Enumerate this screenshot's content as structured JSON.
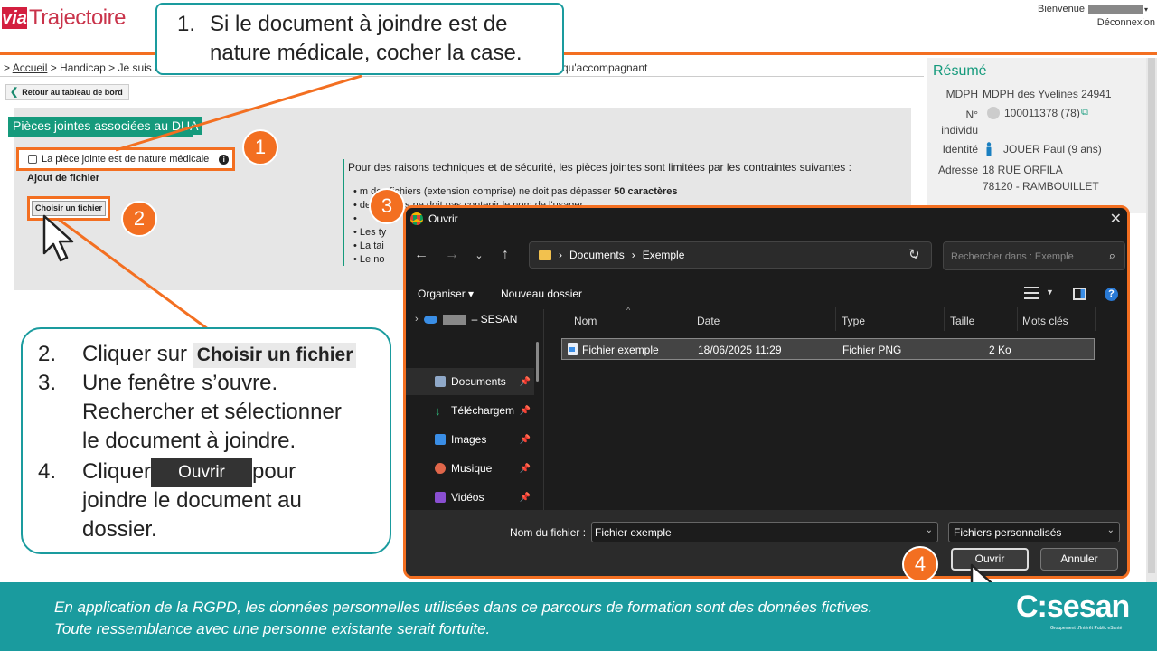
{
  "header": {
    "logo_via": "via",
    "logo_name": "Trajectoire",
    "welcome": "Bienvenue",
    "logout": "Déconnexion"
  },
  "breadcrumb": {
    "prefix": ">",
    "home": "Accueil",
    "rest": "> Handicap > Je suis a",
    "tail": "qu'accompagnant"
  },
  "back_button": "Retour au tableau de bord",
  "attachments": {
    "title": "Pièces jointes associées au DUA",
    "medical_checkbox": "La pièce jointe est de nature médicale",
    "add_file": "Ajout de fichier",
    "choose_file": "Choisir un fichier",
    "constraints_intro": "Pour des raisons techniques et de sécurité, les pièces jointes sont limitées par les contraintes suivantes :",
    "bullets": [
      "• m des fichiers (extension comprise) ne doit pas dépasser 50 caractères",
      "• des fichiers ne doit pas contenir le nom de l'usager",
      "•",
      "• Les ty",
      "• La tai",
      "• Le no"
    ]
  },
  "summary": {
    "title": "Résumé",
    "rows": [
      {
        "label": "MDPH",
        "value": "MDPH des Yvelines 24941"
      },
      {
        "label": "N° individu",
        "value": "100011378 (78)"
      },
      {
        "label": "Identité",
        "value": "JOUER Paul (9 ans)"
      },
      {
        "label": "Adresse",
        "value": "18 RUE ORFILA"
      },
      {
        "label": "",
        "value": "78120 - RAMBOUILLET"
      }
    ]
  },
  "dialog": {
    "title": "Ouvrir",
    "path": [
      "Documents",
      "Exemple"
    ],
    "search_placeholder": "Rechercher dans : Exemple",
    "organise": "Organiser ▾",
    "new_folder": "Nouveau dossier",
    "onedrive": "– SESAN",
    "sidebar": [
      {
        "label": "Documents",
        "icon": "documents-icon",
        "color": "#8fa8c8"
      },
      {
        "label": "Téléchargem",
        "icon": "download-icon",
        "color": "#2fb87a"
      },
      {
        "label": "Images",
        "icon": "images-icon",
        "color": "#3a8ee6"
      },
      {
        "label": "Musique",
        "icon": "music-icon",
        "color": "#e0664a"
      },
      {
        "label": "Vidéos",
        "icon": "videos-icon",
        "color": "#8a4fd1"
      }
    ],
    "columns": [
      "Nom",
      "Date",
      "Type",
      "Taille",
      "Mots clés"
    ],
    "files": [
      {
        "name": "Fichier exemple",
        "date": "18/06/2025 11:29",
        "type": "Fichier PNG",
        "size": "2 Ko"
      }
    ],
    "filename_label": "Nom du fichier :",
    "filename_value": "Fichier exemple",
    "file_type": "Fichiers personnalisés",
    "open": "Ouvrir",
    "cancel": "Annuler"
  },
  "callouts": {
    "step1_num": "1.",
    "step1_text": "Si le document à joindre est de nature médicale, cocher la case.",
    "step2_num": "2.",
    "step2_text": "Cliquer sur",
    "step2_chip": "Choisir un fichier",
    "step3_num": "3.",
    "step3_l1": "Une fenêtre s’ouvre.",
    "step3_l2": "Rechercher et sélectionner",
    "step3_l3": "le document à joindre.",
    "step4_num": "4.",
    "step4_a": "Cliquer",
    "step4_chip": "Ouvrir",
    "step4_b": "pour",
    "step4_l2": "joindre le document au",
    "step4_l3": "dossier."
  },
  "badges": [
    "1",
    "2",
    "3",
    "4"
  ],
  "footer": {
    "line1": "En application de la RGPD, les données personnelles utilisées dans ce parcours de formation sont des données fictives.",
    "line2": "Toute ressemblance avec une personne existante serait fortuite.",
    "brand": "sesan",
    "brand_sub": "Groupement d'Intérêt Public eSanté"
  },
  "colors": {
    "accent": "#f36f21",
    "teal": "#1a9b9e",
    "green": "#159a7c"
  }
}
